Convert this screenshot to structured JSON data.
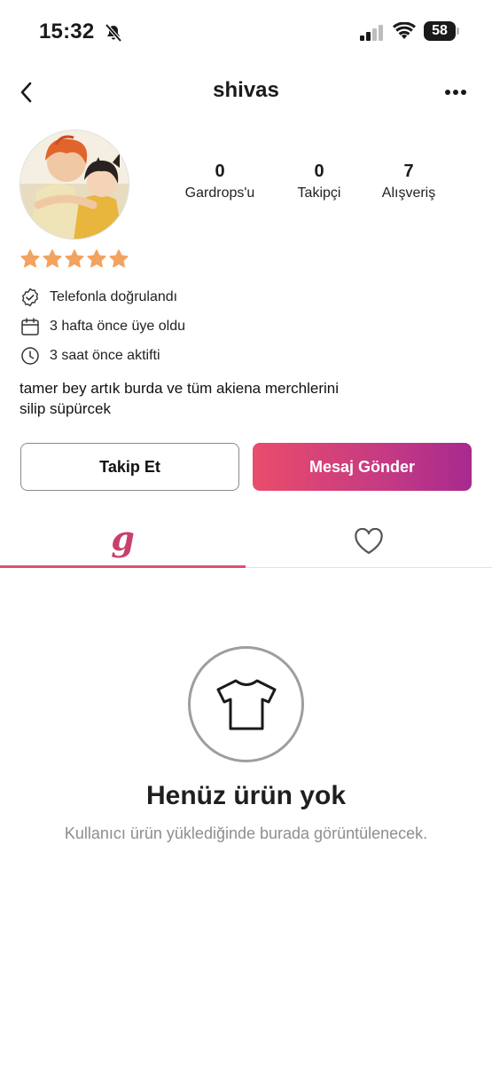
{
  "status_bar": {
    "time": "15:32",
    "battery": "58"
  },
  "header": {
    "title": "shivas",
    "back_icon": "chevron-left-icon",
    "more_icon": "ellipsis-icon"
  },
  "profile": {
    "stats": [
      {
        "value": "0",
        "label": "Gardrops'u"
      },
      {
        "value": "0",
        "label": "Takipçi"
      },
      {
        "value": "7",
        "label": "Alışveriş"
      }
    ],
    "rating": 5,
    "star_color": "#f2a35e",
    "info": [
      {
        "icon": "verified-badge-icon",
        "text": "Telefonla doğrulandı"
      },
      {
        "icon": "calendar-icon",
        "text": "3 hafta önce üye oldu"
      },
      {
        "icon": "clock-icon",
        "text": "3 saat önce aktifti"
      }
    ],
    "bio_line1": "tamer bey artık burda ve tüm akiena merchlerini",
    "bio_line2": "silip süpürcek"
  },
  "actions": {
    "follow": "Takip Et",
    "message": "Mesaj Gönder"
  },
  "tabs": {
    "wardrobe_icon_text": "g",
    "active": "wardrobe",
    "accent_color": "#e0506f"
  },
  "empty_state": {
    "icon": "tshirt-icon",
    "title": "Henüz ürün yok",
    "subtitle": "Kullanıcı ürün yüklediğinde burada görüntülenecek."
  }
}
